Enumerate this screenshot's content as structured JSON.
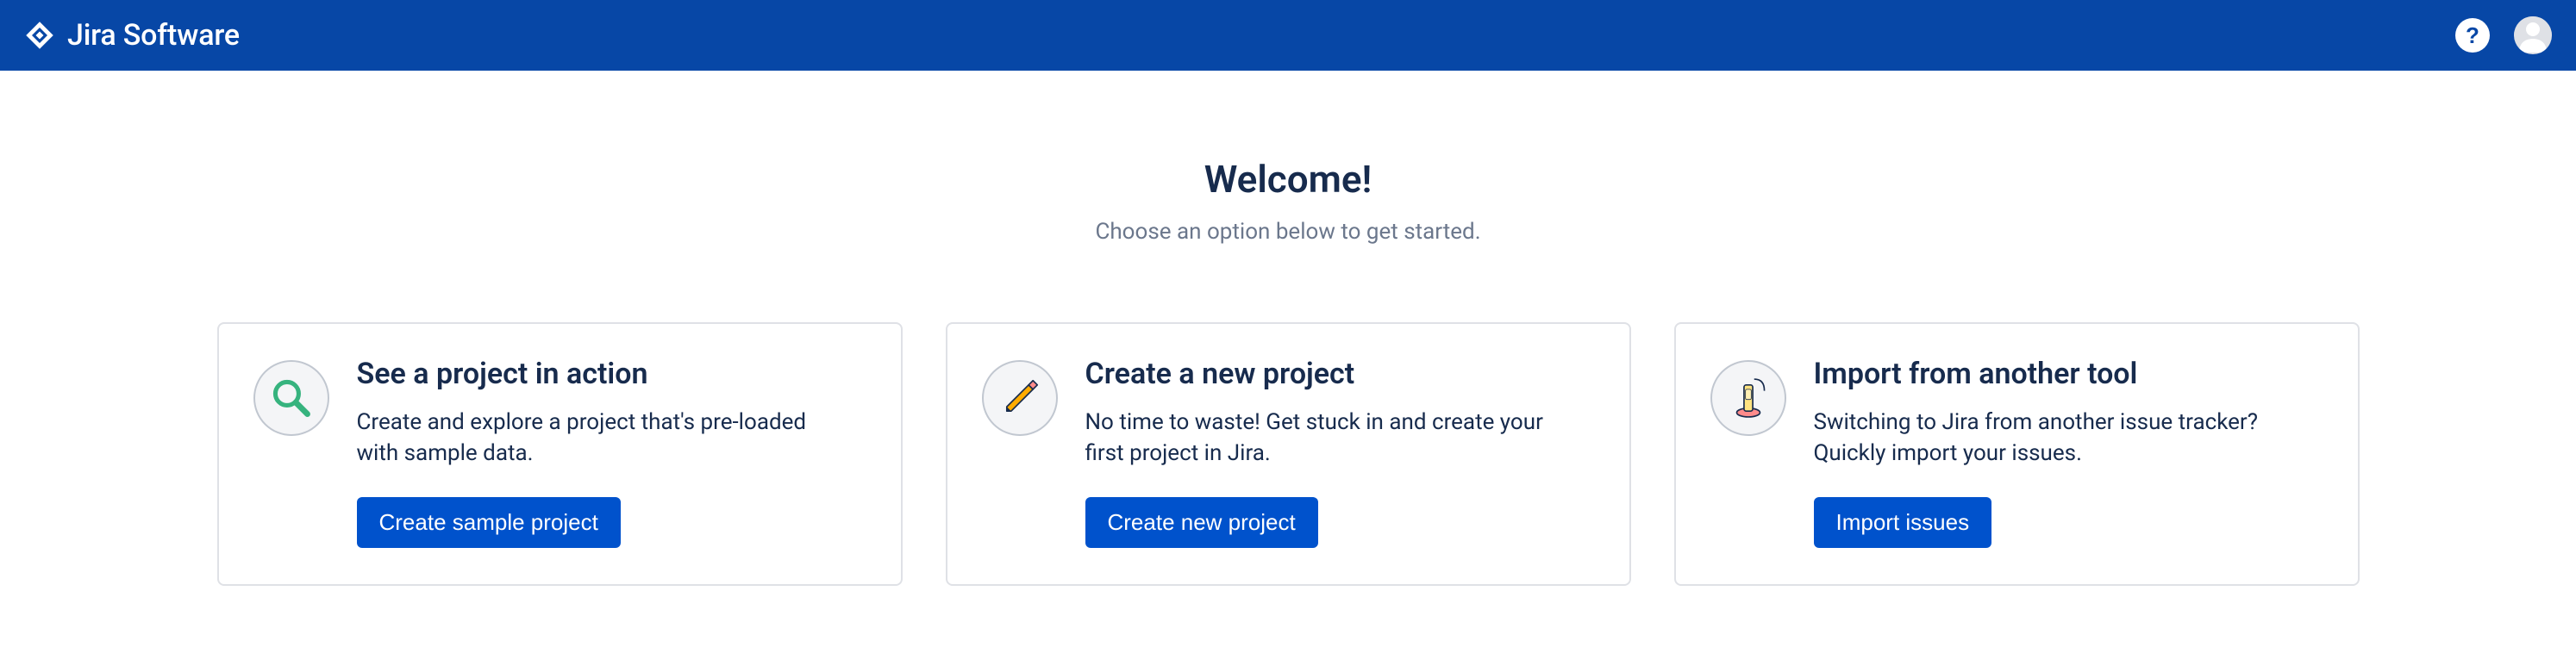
{
  "header": {
    "brand": "Jira Software",
    "help_glyph": "?"
  },
  "welcome": {
    "title": "Welcome!",
    "subtitle": "Choose an option below to get started."
  },
  "cards": [
    {
      "title": "See a project in action",
      "description": "Create and explore a project that's pre-loaded with sample data.",
      "button": "Create sample project"
    },
    {
      "title": "Create a new project",
      "description": "No time to waste! Get stuck in and create your first project in Jira.",
      "button": "Create new project"
    },
    {
      "title": "Import from another tool",
      "description": "Switching to Jira from another issue tracker? Quickly import your issues.",
      "button": "Import issues"
    }
  ]
}
